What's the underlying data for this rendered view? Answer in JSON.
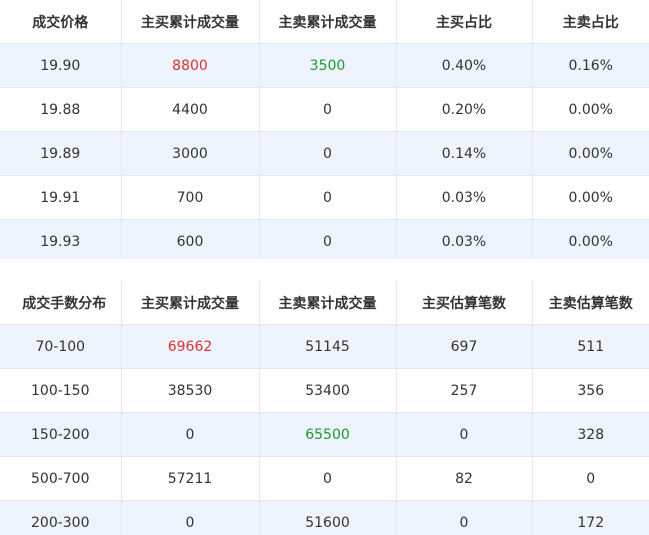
{
  "price_table": {
    "headers": [
      "成交价格",
      "主买累计成交量",
      "主卖累计成交量",
      "主买占比",
      "主卖占比"
    ],
    "rows": [
      {
        "price": "19.90",
        "buy_vol": "8800",
        "sell_vol": "3500",
        "buy_pct": "0.40%",
        "sell_pct": "0.16%"
      },
      {
        "price": "19.88",
        "buy_vol": "4400",
        "sell_vol": "0",
        "buy_pct": "0.20%",
        "sell_pct": "0.00%"
      },
      {
        "price": "19.89",
        "buy_vol": "3000",
        "sell_vol": "0",
        "buy_pct": "0.14%",
        "sell_pct": "0.00%"
      },
      {
        "price": "19.91",
        "buy_vol": "700",
        "sell_vol": "0",
        "buy_pct": "0.03%",
        "sell_pct": "0.00%"
      },
      {
        "price": "19.93",
        "buy_vol": "600",
        "sell_vol": "0",
        "buy_pct": "0.03%",
        "sell_pct": "0.00%"
      }
    ]
  },
  "lot_table": {
    "headers": [
      "成交手数分布",
      "主买累计成交量",
      "主卖累计成交量",
      "主买估算笔数",
      "主卖估算笔数"
    ],
    "rows": [
      {
        "range": "70-100",
        "buy_vol": "69662",
        "sell_vol": "51145",
        "buy_count": "697",
        "sell_count": "511"
      },
      {
        "range": "100-150",
        "buy_vol": "38530",
        "sell_vol": "53400",
        "buy_count": "257",
        "sell_count": "356"
      },
      {
        "range": "150-200",
        "buy_vol": "0",
        "sell_vol": "65500",
        "buy_count": "0",
        "sell_count": "328"
      },
      {
        "range": "500-700",
        "buy_vol": "57211",
        "sell_vol": "0",
        "buy_count": "82",
        "sell_count": "0"
      },
      {
        "range": "200-300",
        "buy_vol": "0",
        "sell_vol": "51600",
        "buy_count": "0",
        "sell_count": "172"
      }
    ]
  },
  "colors": {
    "up": "#e0312f",
    "down": "#1a9a2e",
    "row_stripe": "#eef4fd",
    "border": "#e3e8f0"
  }
}
